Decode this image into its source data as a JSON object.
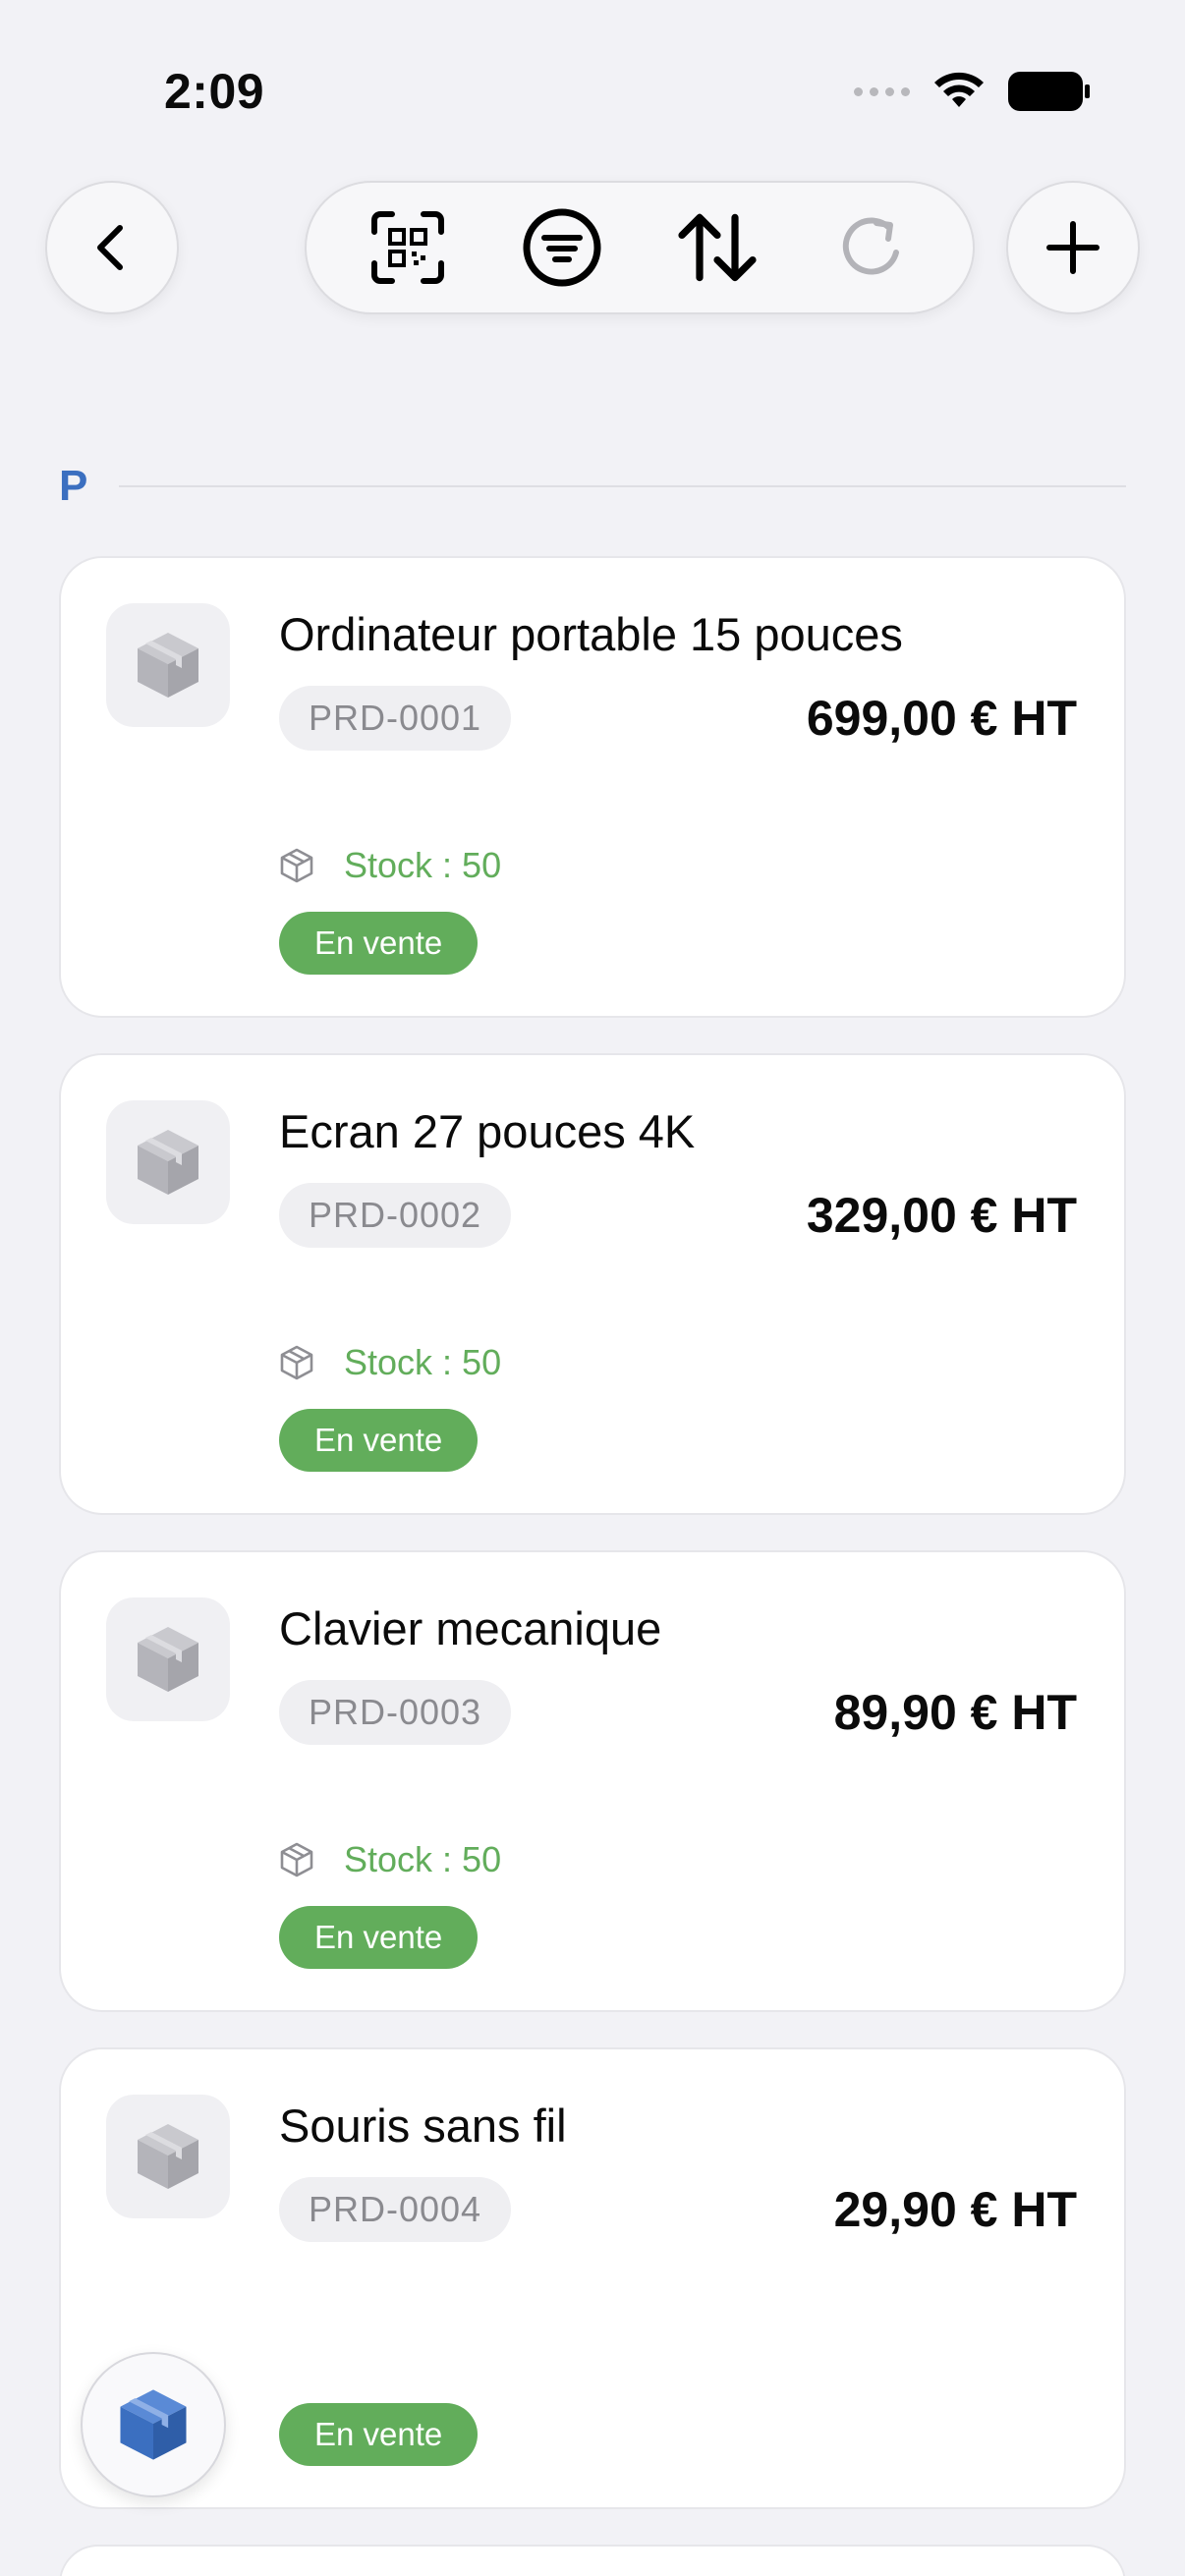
{
  "status_bar": {
    "time": "2:09"
  },
  "section": {
    "letter": "P"
  },
  "products": [
    {
      "name": "Ordinateur portable 15 pouces",
      "ref": "PRD-0001",
      "price": "699,00 € HT",
      "stock": "Stock : 50",
      "status": "En vente"
    },
    {
      "name": "Ecran 27 pouces 4K",
      "ref": "PRD-0002",
      "price": "329,00 € HT",
      "stock": "Stock : 50",
      "status": "En vente"
    },
    {
      "name": "Clavier mecanique",
      "ref": "PRD-0003",
      "price": "89,90 € HT",
      "stock": "Stock : 50",
      "status": "En vente"
    },
    {
      "name": "Souris sans fil",
      "ref": "PRD-0004",
      "price": "29,90 € HT",
      "stock": "",
      "status": "En vente"
    }
  ],
  "icons": {
    "back": "chevron-left-icon",
    "scan": "qr-scan-icon",
    "filter": "filter-icon",
    "sort": "sort-icon",
    "refresh": "refresh-icon",
    "add": "plus-icon",
    "product": "package-icon"
  },
  "colors": {
    "accent": "#3b6fc0",
    "stock_green": "#62ad5b",
    "status_badge": "#62ad5b"
  }
}
